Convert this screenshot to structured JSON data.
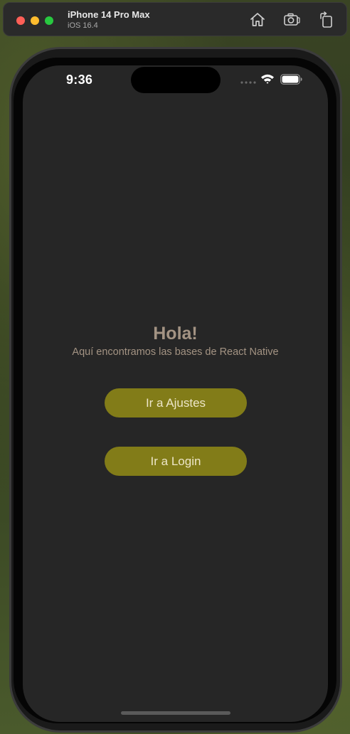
{
  "simulator": {
    "device_name": "iPhone 14 Pro Max",
    "os_version": "iOS 16.4",
    "toolbar_icons": [
      "home-icon",
      "screenshot-icon",
      "rotate-icon"
    ]
  },
  "status_bar": {
    "time": "9:36",
    "icons": [
      "signal-icon",
      "wifi-icon",
      "battery-icon"
    ]
  },
  "main": {
    "title": "Hola!",
    "subtitle": "Aquí encontramos las bases de React Native",
    "buttons": [
      {
        "label": "Ir a Ajustes"
      },
      {
        "label": "Ir a Login"
      }
    ]
  },
  "colors": {
    "background": "#262626",
    "text": "#a39383",
    "button": "#827c18",
    "button_text": "#ede6c8"
  }
}
